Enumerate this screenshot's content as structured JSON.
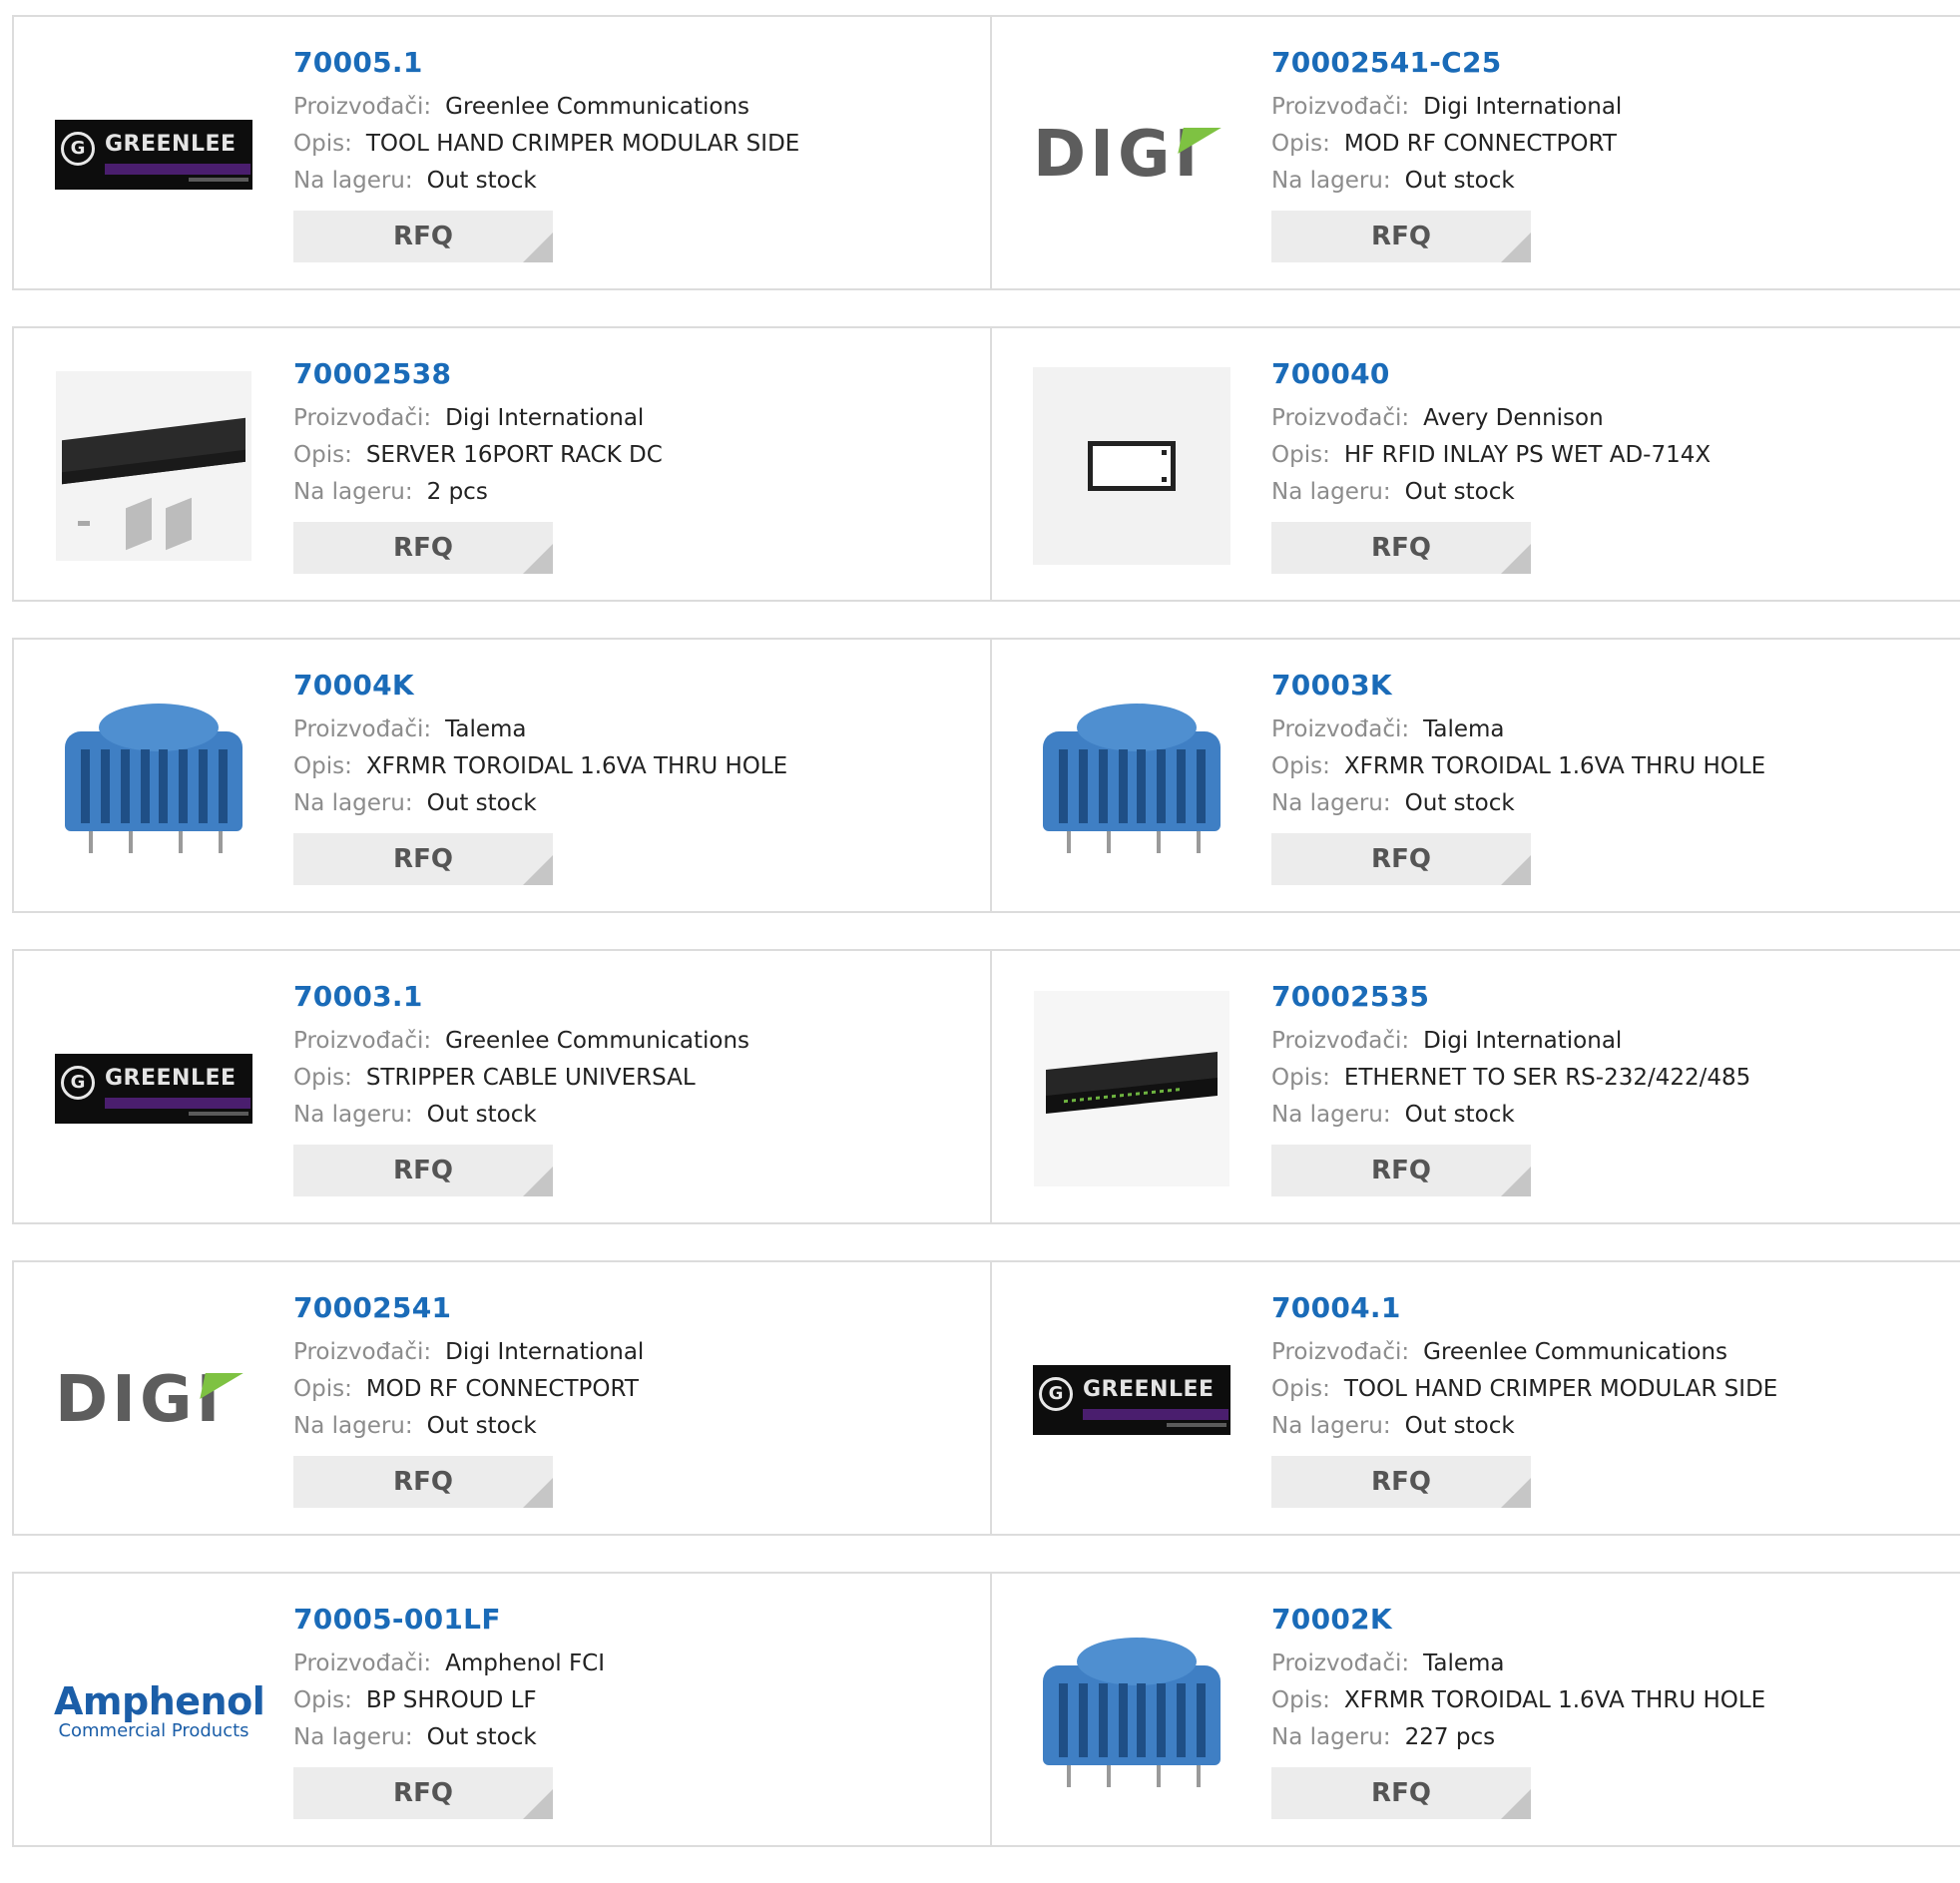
{
  "labels": {
    "manufacturer": "Proizvođači:",
    "description": "Opis:",
    "stock": "Na lageru:",
    "button": "RFQ"
  },
  "rows": [
    [
      {
        "part": "70005.1",
        "manufacturer": "Greenlee Communications",
        "description": "TOOL HAND CRIMPER MODULAR SIDE",
        "stock": "Out stock",
        "image": "greenlee-logo"
      },
      {
        "part": "70002541-C25",
        "manufacturer": "Digi International",
        "description": "MOD RF CONNECTPORT",
        "stock": "Out stock",
        "image": "digi-logo"
      }
    ],
    [
      {
        "part": "70002538",
        "manufacturer": "Digi International",
        "description": "SERVER 16PORT RACK DC",
        "stock": "2 pcs",
        "image": "rack-server-photo"
      },
      {
        "part": "700040",
        "manufacturer": "Avery Dennison",
        "description": "HF RFID INLAY PS WET AD-714X",
        "stock": "Out stock",
        "image": "rfid-inlay-photo"
      }
    ],
    [
      {
        "part": "70004K",
        "manufacturer": "Talema",
        "description": "XFRMR TOROIDAL 1.6VA THRU HOLE",
        "stock": "Out stock",
        "image": "transformer-photo"
      },
      {
        "part": "70003K",
        "manufacturer": "Talema",
        "description": "XFRMR TOROIDAL 1.6VA THRU HOLE",
        "stock": "Out stock",
        "image": "transformer-photo"
      }
    ],
    [
      {
        "part": "70003.1",
        "manufacturer": "Greenlee Communications",
        "description": "STRIPPER CABLE UNIVERSAL",
        "stock": "Out stock",
        "image": "greenlee-logo"
      },
      {
        "part": "70002535",
        "manufacturer": "Digi International",
        "description": "ETHERNET TO SER RS-232/422/485",
        "stock": "Out stock",
        "image": "serial-server-photo"
      }
    ],
    [
      {
        "part": "70002541",
        "manufacturer": "Digi International",
        "description": "MOD RF CONNECTPORT",
        "stock": "Out stock",
        "image": "digi-logo"
      },
      {
        "part": "70004.1",
        "manufacturer": "Greenlee Communications",
        "description": "TOOL HAND CRIMPER MODULAR SIDE",
        "stock": "Out stock",
        "image": "greenlee-logo"
      }
    ],
    [
      {
        "part": "70005-001LF",
        "manufacturer": "Amphenol FCI",
        "description": "BP SHROUD LF",
        "stock": "Out stock",
        "image": "amphenol-logo"
      },
      {
        "part": "70002K",
        "manufacturer": "Talema",
        "description": "XFRMR TOROIDAL 1.6VA THRU HOLE",
        "stock": "227 pcs",
        "image": "transformer-photo"
      }
    ]
  ],
  "logos": {
    "greenlee": "GREENLEE",
    "digi": "DIGI",
    "amphenol_word": "Amphenol",
    "amphenol_sub": "Commercial Products"
  },
  "colors": {
    "part_link": "#1a6bb8",
    "label": "#8c8c8c",
    "value": "#222222",
    "button_bg": "#ececec",
    "border": "#dcdcdc"
  }
}
